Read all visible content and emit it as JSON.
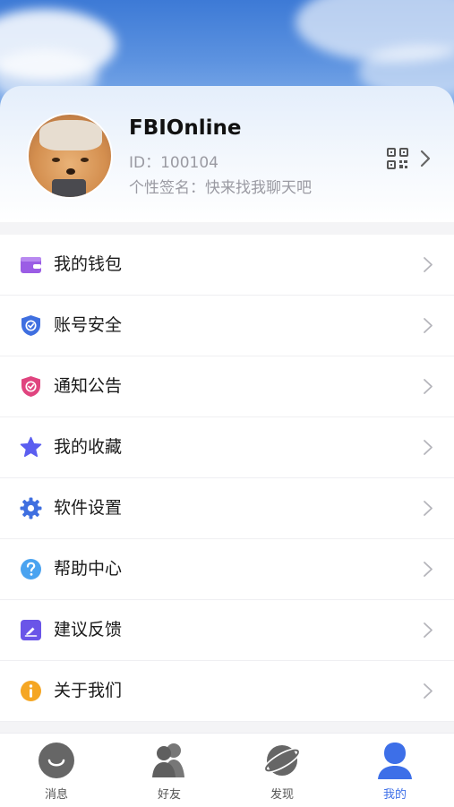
{
  "profile": {
    "name": "FBIOnline",
    "id_text": "ID：100104",
    "signature": "个性签名：快来找我聊天吧"
  },
  "menu": [
    {
      "label": "我的钱包",
      "icon": "wallet-icon",
      "color": "#9b5de5"
    },
    {
      "label": "账号安全",
      "icon": "shield-icon",
      "color": "#3f6fe0"
    },
    {
      "label": "通知公告",
      "icon": "notice-icon",
      "color": "#e0447f"
    },
    {
      "label": "我的收藏",
      "icon": "star-icon",
      "color": "#5b5ef0"
    },
    {
      "label": "软件设置",
      "icon": "gear-icon",
      "color": "#3f6fe0"
    },
    {
      "label": "帮助中心",
      "icon": "help-icon",
      "color": "#4aa3f0"
    },
    {
      "label": "建议反馈",
      "icon": "feedback-icon",
      "color": "#6a55e8"
    },
    {
      "label": "关于我们",
      "icon": "info-icon",
      "color": "#f5a623"
    }
  ],
  "tabs": [
    {
      "label": "消息",
      "icon": "message-icon"
    },
    {
      "label": "好友",
      "icon": "friends-icon"
    },
    {
      "label": "发现",
      "icon": "planet-icon"
    },
    {
      "label": "我的",
      "icon": "user-icon",
      "active": true
    }
  ],
  "colors": {
    "accent": "#3d6fe8",
    "inactive_tab": "#555555"
  }
}
